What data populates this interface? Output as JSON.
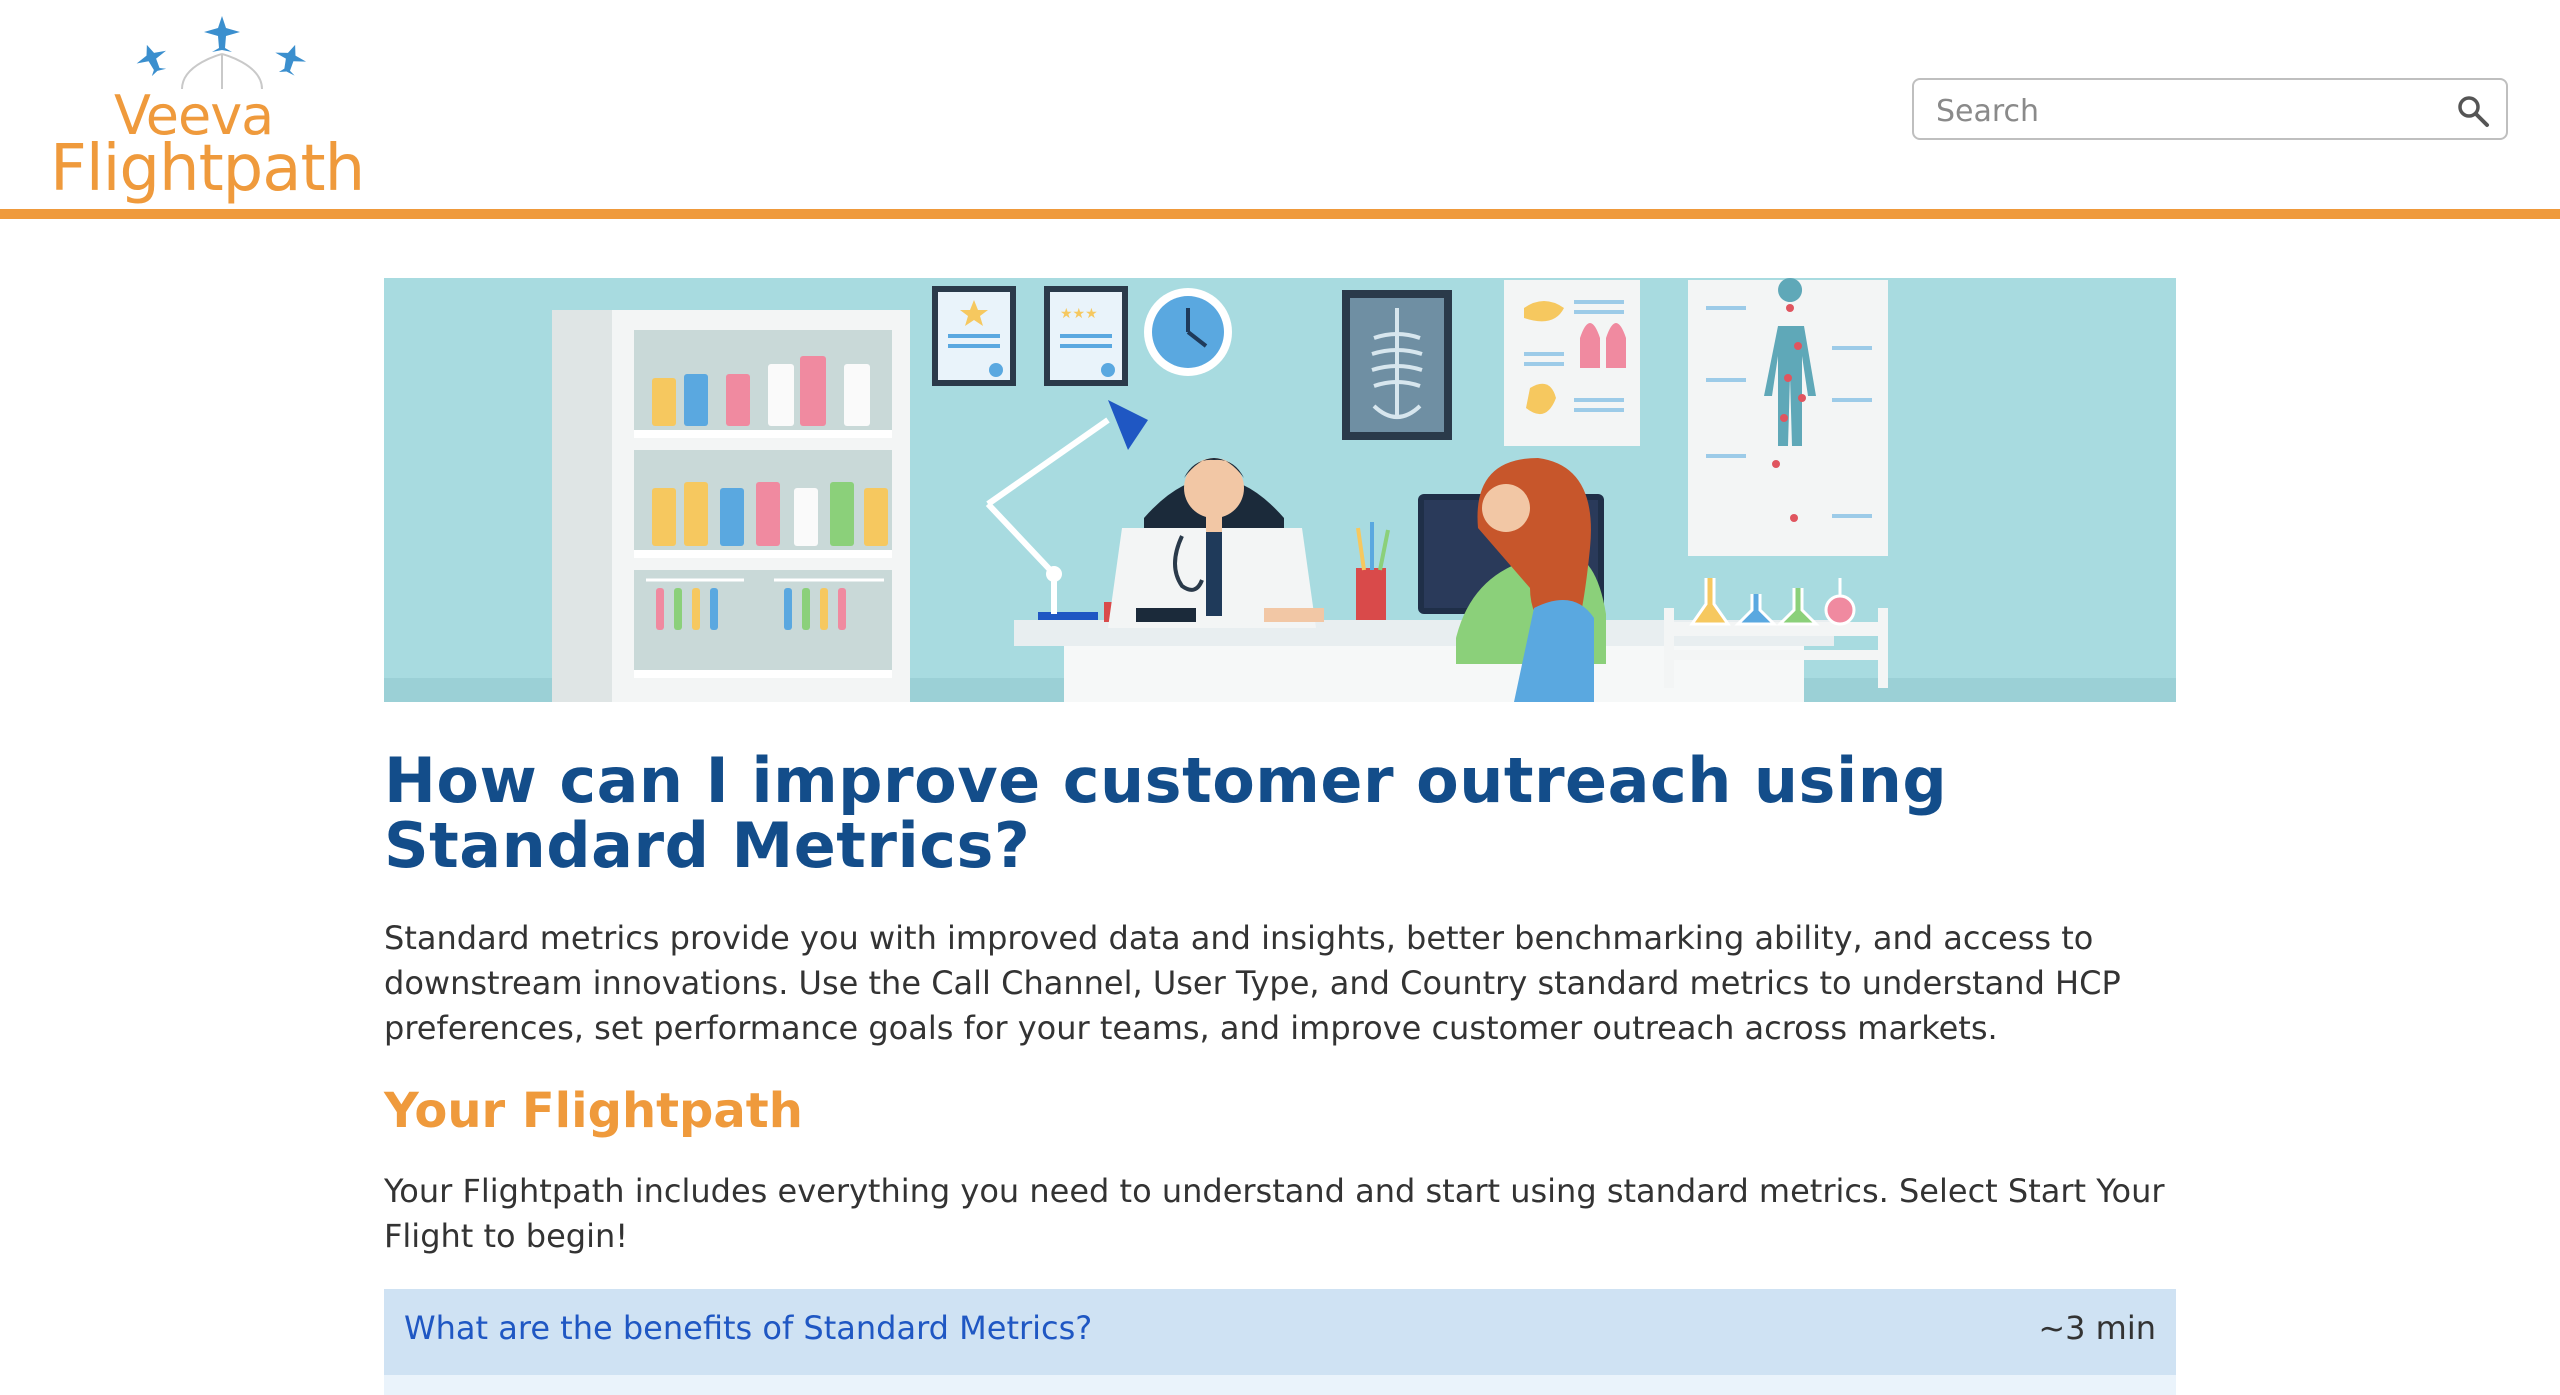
{
  "header": {
    "logo": {
      "line1": "Veeva",
      "line2": "Flightpath"
    },
    "search": {
      "placeholder": "Search"
    }
  },
  "article": {
    "title": "How can I improve customer outreach using Standard Metrics?",
    "intro": "Standard metrics provide you with improved data and insights, better benchmarking ability, and access to downstream innovations. Use the Call Channel, User Type, and Country standard metrics to understand HCP preferences, set performance goals for your teams, and improve customer outreach across markets.",
    "section_title": "Your Flightpath",
    "section_desc": "Your Flightpath includes everything you need to understand and start using standard metrics. Select Start Your Flight to begin!",
    "steps": [
      {
        "label": "What are the benefits of Standard Metrics?",
        "duration": "~3 min"
      }
    ]
  },
  "colors": {
    "accent": "#ef9a3c",
    "title": "#134d8a",
    "link": "#1f57c3",
    "row_bg": "#cfe2f3",
    "hero_bg": "#a8dbe0"
  },
  "icons": [
    "airplane-icon",
    "search-icon"
  ]
}
